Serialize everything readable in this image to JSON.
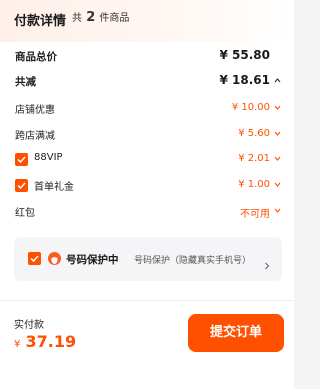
{
  "header": {
    "title": "付款详情",
    "count_prefix": "共",
    "count": "2",
    "count_suffix": "件商品"
  },
  "rows": {
    "goods_total": {
      "label": "商品总价",
      "value": "¥ 55.80"
    },
    "discount_total": {
      "label": "共减",
      "value": "¥ 18.61"
    },
    "shop_discount": {
      "label": "店铺优惠",
      "value": "¥ 10.00"
    },
    "cross_store": {
      "label": "跨店满减",
      "value": "¥ 5.60"
    },
    "vip88": {
      "label": "88VIP",
      "value": "¥ 2.01",
      "checked": true
    },
    "first_order_gift": {
      "label": "首单礼金",
      "value": "¥ 1.00",
      "checked": true
    },
    "red_packet": {
      "label": "红包",
      "value": "不可用"
    }
  },
  "protection": {
    "checked": true,
    "title": "号码保护中",
    "description": "号码保护（隐藏真实手机号）"
  },
  "footer": {
    "pay_label": "实付款",
    "currency": "¥",
    "amount": "37.19",
    "submit_label": "提交订单"
  },
  "colors": {
    "accent": "#ff5000",
    "text": "#1a1a1a",
    "muted": "#555555"
  }
}
